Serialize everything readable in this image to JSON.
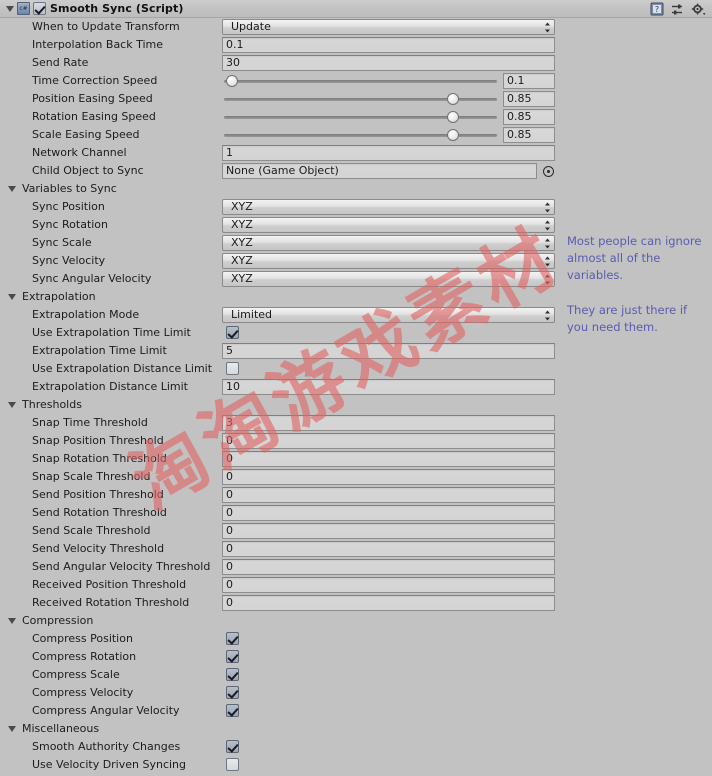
{
  "component": {
    "title": "Smooth Sync (Script)",
    "enabled": true,
    "script_icon": "c#",
    "icons": [
      "help-icon",
      "preset-icon",
      "gear-icon"
    ]
  },
  "rows": [
    {
      "label": "When to Update Transform",
      "type": "popup",
      "value": "Update",
      "indent": 1
    },
    {
      "label": "Interpolation Back Time",
      "type": "text",
      "value": "0.1",
      "indent": 1
    },
    {
      "label": "Send Rate",
      "type": "text",
      "value": "30",
      "indent": 1
    },
    {
      "label": "Time Correction Speed",
      "type": "slider",
      "value": "0.1",
      "percent": 3
    },
    {
      "label": "Position Easing Speed",
      "type": "slider",
      "value": "0.85",
      "percent": 84
    },
    {
      "label": "Rotation Easing Speed",
      "type": "slider",
      "value": "0.85",
      "percent": 84
    },
    {
      "label": "Scale Easing Speed",
      "type": "slider",
      "value": "0.85",
      "percent": 84
    },
    {
      "label": "Network Channel",
      "type": "text",
      "value": "1",
      "indent": 1
    },
    {
      "label": "Child Object to Sync",
      "type": "object",
      "value": "None (Game Object)",
      "indent": 1
    },
    {
      "label": "Variables to Sync",
      "type": "section"
    },
    {
      "label": "Sync Position",
      "type": "popup",
      "value": "XYZ",
      "indent": 2
    },
    {
      "label": "Sync Rotation",
      "type": "popup",
      "value": "XYZ",
      "indent": 2
    },
    {
      "label": "Sync Scale",
      "type": "popup",
      "value": "XYZ",
      "indent": 2
    },
    {
      "label": "Sync Velocity",
      "type": "popup",
      "value": "XYZ",
      "indent": 2
    },
    {
      "label": "Sync Angular Velocity",
      "type": "popup",
      "value": "XYZ",
      "indent": 2
    },
    {
      "label": "Extrapolation",
      "type": "section"
    },
    {
      "label": "Extrapolation Mode",
      "type": "popup",
      "value": "Limited",
      "indent": 2
    },
    {
      "label": "Use Extrapolation Time Limit",
      "type": "check",
      "checked": true,
      "indent": 2
    },
    {
      "label": "Extrapolation Time Limit",
      "type": "text",
      "value": "5",
      "indent": 2
    },
    {
      "label": "Use Extrapolation Distance Limit",
      "type": "check",
      "checked": false,
      "indent": 2
    },
    {
      "label": "Extrapolation Distance Limit",
      "type": "text",
      "value": "10",
      "indent": 2
    },
    {
      "label": "Thresholds",
      "type": "section"
    },
    {
      "label": "Snap Time Threshold",
      "type": "text",
      "value": "3",
      "indent": 2
    },
    {
      "label": "Snap Position Threshold",
      "type": "text",
      "value": "0",
      "indent": 2
    },
    {
      "label": "Snap Rotation Threshold",
      "type": "text",
      "value": "0",
      "indent": 2
    },
    {
      "label": "Snap Scale Threshold",
      "type": "text",
      "value": "0",
      "indent": 2
    },
    {
      "label": "Send Position Threshold",
      "type": "text",
      "value": "0",
      "indent": 2
    },
    {
      "label": "Send Rotation Threshold",
      "type": "text",
      "value": "0",
      "indent": 2
    },
    {
      "label": "Send Scale Threshold",
      "type": "text",
      "value": "0",
      "indent": 2
    },
    {
      "label": "Send Velocity Threshold",
      "type": "text",
      "value": "0",
      "indent": 2
    },
    {
      "label": "Send Angular Velocity Threshold",
      "type": "text",
      "value": "0",
      "indent": 2
    },
    {
      "label": "Received Position Threshold",
      "type": "text",
      "value": "0",
      "indent": 2
    },
    {
      "label": "Received Rotation Threshold",
      "type": "text",
      "value": "0",
      "indent": 2
    },
    {
      "label": "Compression",
      "type": "section"
    },
    {
      "label": "Compress Position",
      "type": "check",
      "checked": true,
      "indent": 2
    },
    {
      "label": "Compress Rotation",
      "type": "check",
      "checked": true,
      "indent": 2
    },
    {
      "label": "Compress Scale",
      "type": "check",
      "checked": true,
      "indent": 2
    },
    {
      "label": "Compress Velocity",
      "type": "check",
      "checked": true,
      "indent": 2
    },
    {
      "label": "Compress Angular Velocity",
      "type": "check",
      "checked": true,
      "indent": 2
    },
    {
      "label": "Miscellaneous",
      "type": "section"
    },
    {
      "label": "Smooth Authority Changes",
      "type": "check",
      "checked": true,
      "indent": 2
    },
    {
      "label": "Use Velocity Driven Syncing",
      "type": "check",
      "checked": false,
      "indent": 2
    }
  ],
  "annotations": [
    {
      "id": "annot1",
      "text": "Most people can ignore almost all of the variables.",
      "color": "#5b5bb0"
    },
    {
      "id": "annot2",
      "text": "They are just there if you need them.",
      "color": "#5b5bb0"
    }
  ],
  "watermark": {
    "text": "淘淘游戏素材",
    "color": "#e16464"
  }
}
